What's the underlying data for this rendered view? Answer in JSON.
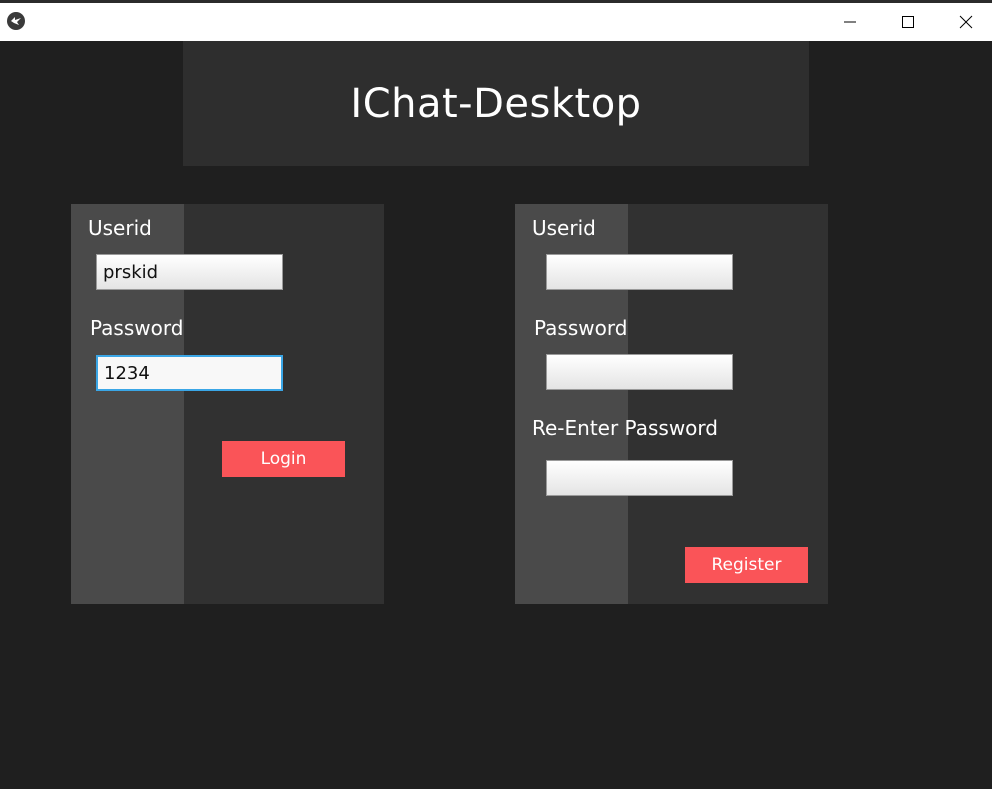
{
  "window": {
    "title": "",
    "icon": "kivy-logo-icon",
    "controls": [
      "minimize-icon",
      "maximize-icon",
      "close-icon"
    ]
  },
  "header": {
    "title": "IChat-Desktop"
  },
  "login": {
    "userid_label": "Userid",
    "userid_value": "prskid",
    "password_label": "Password",
    "password_value": "1234",
    "button_label": "Login"
  },
  "register": {
    "userid_label": "Userid",
    "userid_value": "",
    "password_label": "Password",
    "password_value": "",
    "reenter_label": "Re-Enter Password",
    "reenter_value": "",
    "button_label": "Register"
  },
  "colors": {
    "background": "#1f1f1f",
    "panel": "#313131",
    "panel_stripe": "#4a4a4a",
    "header": "#2e2e2e",
    "accent_button": "#fa5458",
    "focus_border": "#3aa6e6"
  }
}
